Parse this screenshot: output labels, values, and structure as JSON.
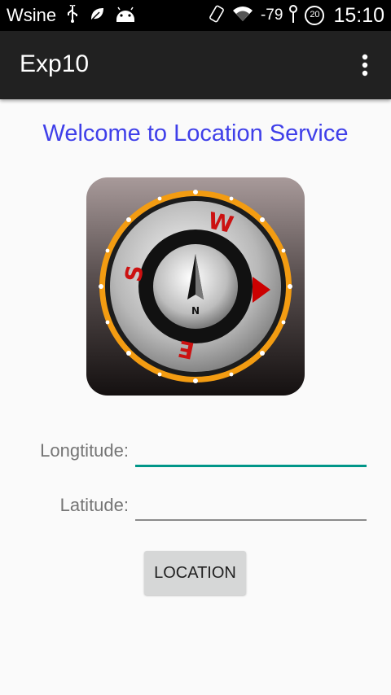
{
  "status_bar": {
    "carrier": "Wsine",
    "signal_strength": "-79",
    "battery_level": "20",
    "time": "15:10"
  },
  "app_bar": {
    "title": "Exp10"
  },
  "main": {
    "welcome_text": "Welcome to Location Service",
    "compass_letters": {
      "north": "N",
      "west": "W",
      "south": "S",
      "east": "E"
    },
    "longitude_label": "Longtitude:",
    "longitude_value": "",
    "latitude_label": "Latitude:",
    "latitude_value": "",
    "location_button": "LOCATION"
  },
  "colors": {
    "accent": "#009688",
    "title_text": "#3f3fe9",
    "app_bar": "#212121",
    "compass_ring": "#f39c12",
    "compass_arrow": "#cc0000"
  }
}
